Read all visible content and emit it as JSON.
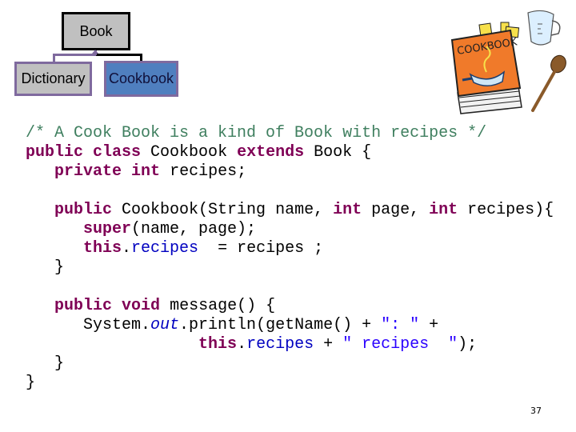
{
  "diagram": {
    "parent_class": "Book",
    "children": [
      {
        "label": "Dictionary",
        "fill": "#c0c0c0"
      },
      {
        "label": "Cookbook",
        "fill": "#4f7fbf"
      }
    ],
    "clipart_label": "COOKBOOK"
  },
  "code": {
    "colors": {
      "keyword": "#7f0055",
      "comment": "#3f7f5f",
      "field": "#0000c0",
      "string": "#2a00ff"
    },
    "lines": [
      [
        {
          "t": "/* A Cook Book is a kind of Book with recipes */",
          "c": "cm"
        }
      ],
      [
        {
          "t": "public",
          "c": "kw"
        },
        {
          "t": " "
        },
        {
          "t": "class",
          "c": "kw"
        },
        {
          "t": " Cookbook "
        },
        {
          "t": "extends",
          "c": "kw"
        },
        {
          "t": " Book {"
        }
      ],
      [
        {
          "t": "   "
        },
        {
          "t": "private",
          "c": "kw"
        },
        {
          "t": " "
        },
        {
          "t": "int",
          "c": "kw"
        },
        {
          "t": " recipes;"
        }
      ],
      [
        {
          "t": ""
        }
      ],
      [
        {
          "t": "   "
        },
        {
          "t": "public",
          "c": "kw"
        },
        {
          "t": " Cookbook(String name, "
        },
        {
          "t": "int",
          "c": "kw"
        },
        {
          "t": " page, "
        },
        {
          "t": "int",
          "c": "kw"
        },
        {
          "t": " recipes){"
        }
      ],
      [
        {
          "t": "      "
        },
        {
          "t": "super",
          "c": "kw"
        },
        {
          "t": "(name, page);"
        }
      ],
      [
        {
          "t": "      "
        },
        {
          "t": "this",
          "c": "kw"
        },
        {
          "t": "."
        },
        {
          "t": "recipes",
          "c": "fld"
        },
        {
          "t": "  = recipes ;"
        }
      ],
      [
        {
          "t": "   }"
        }
      ],
      [
        {
          "t": ""
        }
      ],
      [
        {
          "t": "   "
        },
        {
          "t": "public",
          "c": "kw"
        },
        {
          "t": " "
        },
        {
          "t": "void",
          "c": "kw"
        },
        {
          "t": " message() {"
        }
      ],
      [
        {
          "t": "      System."
        },
        {
          "t": "out",
          "c": "fld-it"
        },
        {
          "t": ".println(getName() + "
        },
        {
          "t": "\": \"",
          "c": "str"
        },
        {
          "t": " +"
        }
      ],
      [
        {
          "t": "                  "
        },
        {
          "t": "this",
          "c": "kw"
        },
        {
          "t": "."
        },
        {
          "t": "recipes",
          "c": "fld"
        },
        {
          "t": " + "
        },
        {
          "t": "\" recipes  \"",
          "c": "str"
        },
        {
          "t": ");"
        }
      ],
      [
        {
          "t": "   }"
        }
      ],
      [
        {
          "t": "}"
        }
      ]
    ]
  },
  "footer": {
    "page_number": "37"
  }
}
